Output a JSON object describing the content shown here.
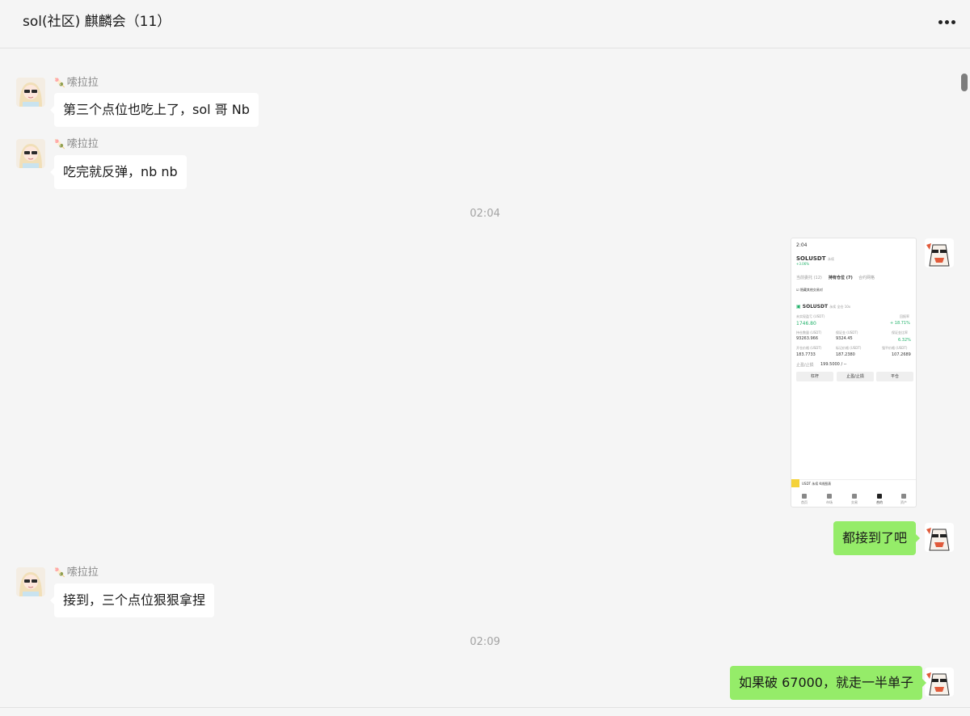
{
  "header": {
    "title": "sol(社区) 麒麟会（11）",
    "more_icon": "more-horizontal-icon"
  },
  "contacts": {
    "other_nick": "嗦拉拉",
    "nick_badge": "🍡"
  },
  "messages": {
    "m1": "第三个点位也吃上了，sol 哥 Nb",
    "m2": "吃完就反弹，nb nb",
    "t1": "02:04",
    "m3": "都接到了吧",
    "m4": "接到，三个点位狠狠拿捏",
    "t2": "02:09",
    "m5": "如果破 67000，就走一半单子"
  },
  "screenshot": {
    "time": "2:04",
    "pair": "SOLUSDT",
    "pair_tag": "永续",
    "change": "+3.06%",
    "tab1": "当前委托 (12)",
    "tab2": "持有仓位 (7)",
    "tab3": "合约网格",
    "hide_other": "隐藏其他交易对",
    "position": "SOLUSDT",
    "position_tags": "永续  全仓 10x",
    "pnl_label": "未实现盈亏 (USDT)",
    "pnl": "1746.80",
    "roe_label": "回报率",
    "roe": "+ 18.71%",
    "size_label": "持仓数量 (USDT)",
    "size": "93263.966",
    "margin_label": "保证金 (USDT)",
    "margin": "9324.45",
    "ratio_label": "保证金比率",
    "ratio": "6.32%",
    "entry_label": "开仓价格 (USDT)",
    "entry": "183.7733",
    "mark_label": "标记价格 (USDT)",
    "mark": "187.2380",
    "liq_label": "强平价格 (USDT)",
    "liq": "107.2689",
    "tpsl_label": "止盈/止损",
    "tpsl": "199.5000 / --",
    "btn1": "杠杆",
    "btn2": "止盈/止损",
    "btn3": "平仓",
    "footer": "USDT 永续  K线图表",
    "nav1": "首页",
    "nav2": "市场",
    "nav3": "交易",
    "nav4": "合约",
    "nav5": "资产"
  }
}
